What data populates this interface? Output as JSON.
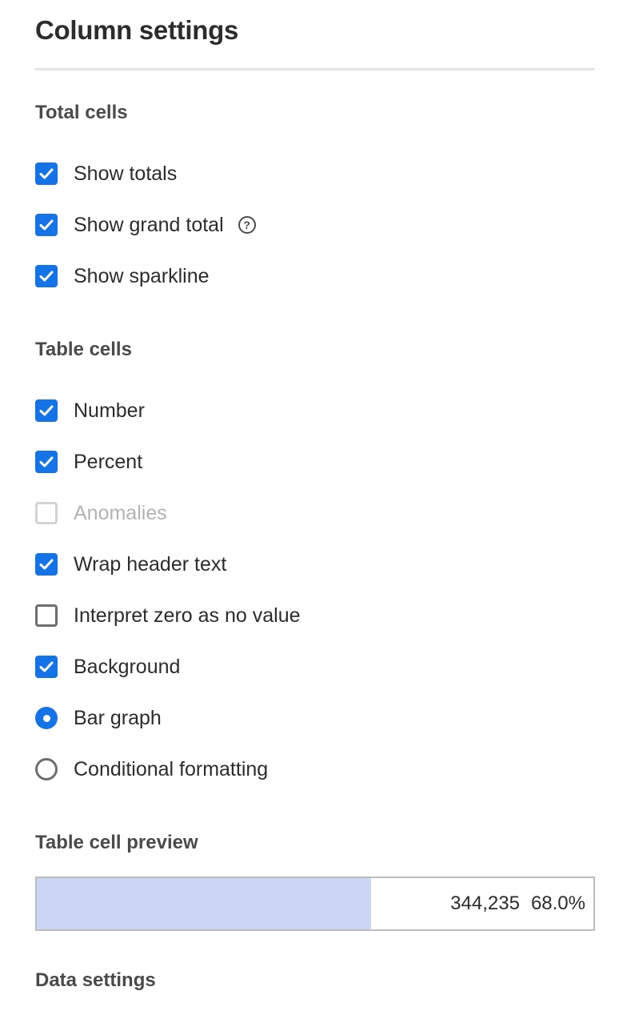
{
  "title": "Column settings",
  "total_cells": {
    "heading": "Total cells",
    "options": [
      {
        "label": "Show totals",
        "checked": true
      },
      {
        "label": "Show grand total",
        "checked": true,
        "help_icon": "help-circle-icon"
      },
      {
        "label": "Show sparkline",
        "checked": true
      }
    ]
  },
  "table_cells": {
    "heading": "Table cells",
    "options": [
      {
        "label": "Number",
        "checked": true
      },
      {
        "label": "Percent",
        "checked": true
      },
      {
        "label": "Anomalies",
        "checked": false,
        "disabled": true
      },
      {
        "label": "Wrap header text",
        "checked": true
      },
      {
        "label": "Interpret zero as no value",
        "checked": false
      },
      {
        "label": "Background",
        "checked": true
      }
    ],
    "background_style": [
      {
        "label": "Bar graph",
        "selected": true
      },
      {
        "label": "Conditional formatting",
        "selected": false
      }
    ]
  },
  "preview": {
    "heading": "Table cell preview",
    "number": "344,235",
    "percent": "68.0%",
    "bar_fill_fraction": 0.6
  },
  "data_settings": {
    "heading": "Data settings"
  },
  "colors": {
    "accent": "#1473e6",
    "bar_fill": "#cbd5f6"
  }
}
